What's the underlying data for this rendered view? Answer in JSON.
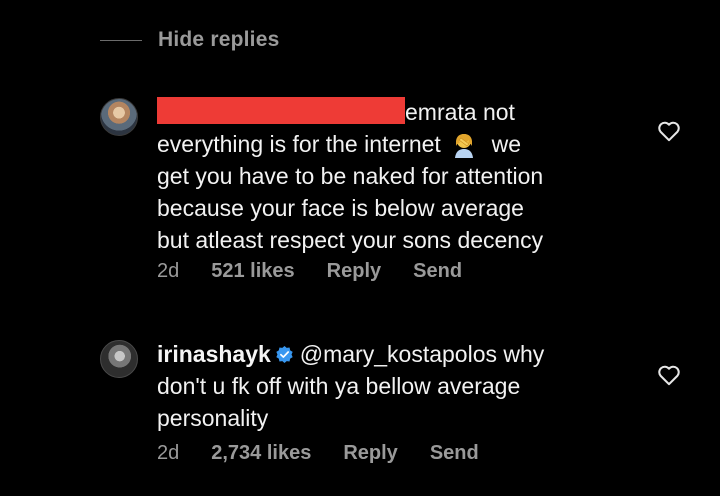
{
  "thread": {
    "hide_replies_label": "Hide replies"
  },
  "comments": [
    {
      "username_redacted": true,
      "lines": [
        "emrata not",
        "everything is for the internet",
        "we",
        "get you have to be naked for attention",
        "because your face is below average",
        "but atleast respect your sons decency"
      ],
      "emoji": "woman-facepalming",
      "time": "2d",
      "likes": "521 likes",
      "reply_label": "Reply",
      "send_label": "Send",
      "heart_icon": "heart-outline-icon"
    },
    {
      "username": "irinashayk",
      "verified": true,
      "mention": "@mary_kostapolos",
      "lines": [
        "why",
        "don't u fk off with ya bellow average",
        "personality"
      ],
      "time": "2d",
      "likes": "2,734 likes",
      "reply_label": "Reply",
      "send_label": "Send",
      "heart_icon": "heart-outline-icon"
    }
  ],
  "colors": {
    "background": "#000000",
    "text_primary": "#f2f2f2",
    "text_secondary": "#9a9a9a",
    "redaction": "#ee3b36",
    "verified": "#3897f0"
  }
}
